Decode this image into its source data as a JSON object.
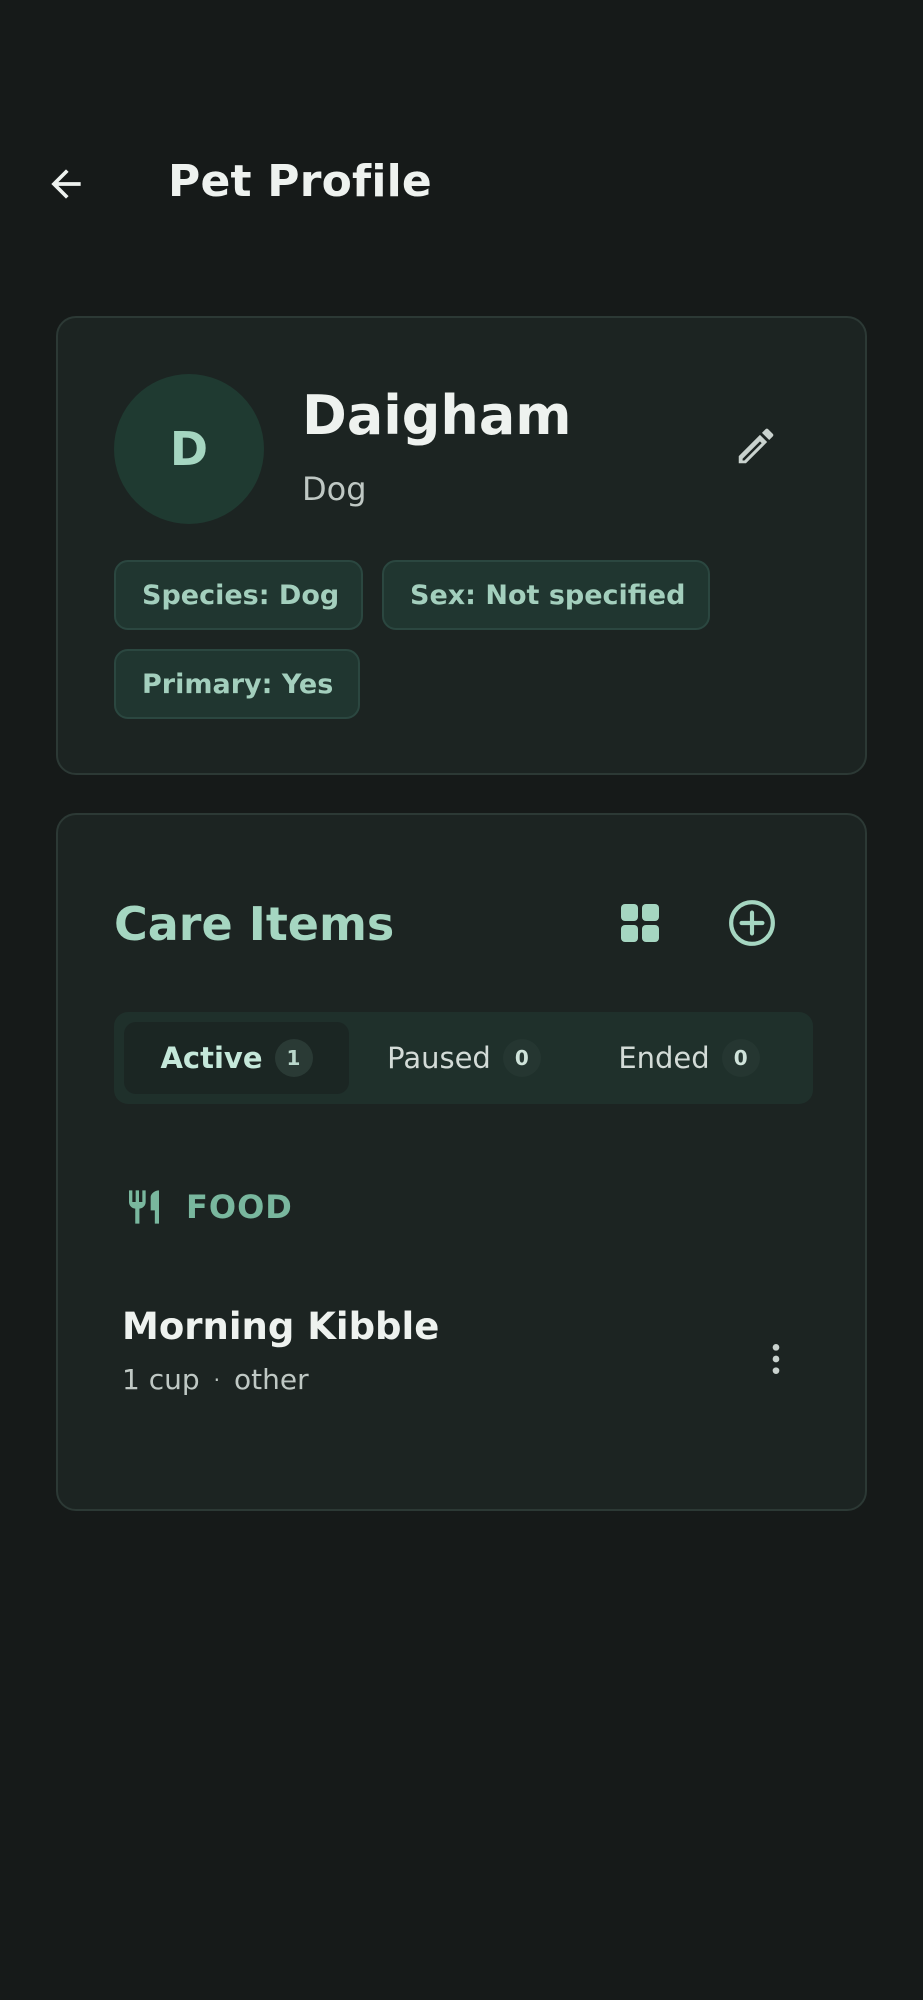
{
  "app_bar": {
    "title": "Pet Profile"
  },
  "profile": {
    "avatar_initial": "D",
    "name": "Daigham",
    "species": "Dog",
    "chips": {
      "species": "Species: Dog",
      "sex": "Sex: Not specified",
      "primary": "Primary: Yes"
    }
  },
  "care_items": {
    "title": "Care Items",
    "tabs": [
      {
        "label": "Active",
        "count": "1"
      },
      {
        "label": "Paused",
        "count": "0"
      },
      {
        "label": "Ended",
        "count": "0"
      }
    ],
    "sections": [
      {
        "label": "FOOD",
        "items": [
          {
            "title": "Morning Kibble",
            "amount": "1 cup",
            "separator": "·",
            "type": "other"
          }
        ]
      }
    ]
  },
  "icons": {
    "back": "arrow-left",
    "edit": "pencil",
    "grid": "grid",
    "add": "plus-circle",
    "food": "fork-knife",
    "more": "more-vertical"
  },
  "colors": {
    "background": "#161a19",
    "card": "#1c2422",
    "accent": "#a5d6c1",
    "section_accent": "#79b79e"
  }
}
